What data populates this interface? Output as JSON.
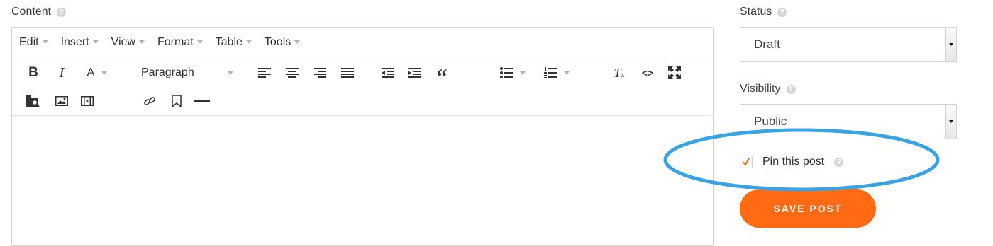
{
  "content": {
    "label": "Content",
    "menu": [
      {
        "label": "Edit"
      },
      {
        "label": "Insert"
      },
      {
        "label": "View"
      },
      {
        "label": "Format"
      },
      {
        "label": "Table"
      },
      {
        "label": "Tools"
      }
    ],
    "toolbar": {
      "block_format": "Paragraph"
    }
  },
  "sidebar": {
    "status": {
      "label": "Status",
      "value": "Draft"
    },
    "visibility": {
      "label": "Visibility",
      "value": "Public"
    },
    "pin": {
      "label": "Pin this post",
      "checked": true
    },
    "save_label": "SAVE POST"
  },
  "colors": {
    "accent": "#ff6a13",
    "highlight": "#3aa3e3"
  }
}
